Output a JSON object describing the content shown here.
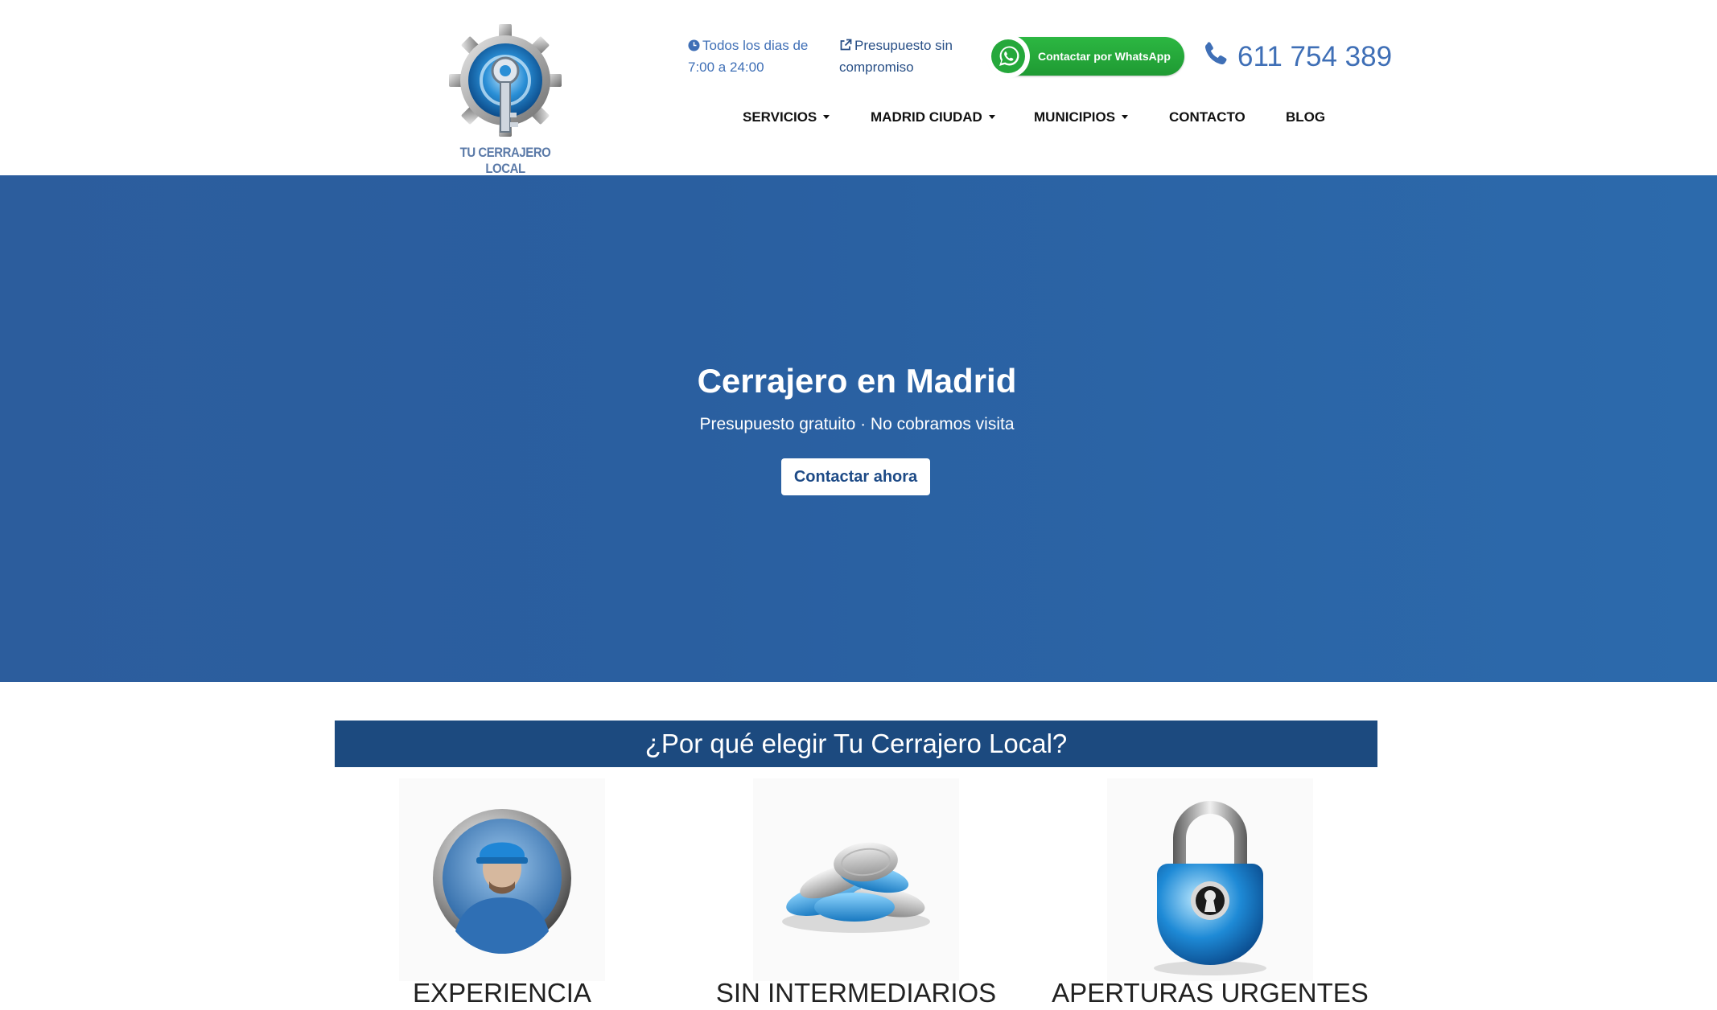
{
  "header": {
    "logo_text": "TU CERRAJERO LOCAL",
    "hours_text": "Todos los dias de 7:00 a 24:00",
    "quote_text": "Presupuesto sin compromiso",
    "whatsapp_label": "Contactar por WhatsApp",
    "phone": "611 754 389"
  },
  "nav": {
    "items": [
      {
        "label": "SERVICIOS",
        "dropdown": true
      },
      {
        "label": "MADRID CIUDAD",
        "dropdown": true
      },
      {
        "label": "MUNICIPIOS",
        "dropdown": true
      },
      {
        "label": "CONTACTO",
        "dropdown": false
      },
      {
        "label": "BLOG",
        "dropdown": false
      }
    ]
  },
  "hero": {
    "title": "Cerrajero en Madrid",
    "subtitle": "Presupuesto gratuito · No cobramos visita",
    "cta_label": "Contactar ahora"
  },
  "why": {
    "heading": "¿Por qué elegir Tu Cerrajero Local?",
    "features": [
      {
        "label": "EXPERIENCIA",
        "icon": "locksmith-worker-icon"
      },
      {
        "label": "SIN INTERMEDIARIOS",
        "icon": "coins-icon"
      },
      {
        "label": "APERTURAS URGENTES",
        "icon": "padlock-icon"
      }
    ]
  },
  "colors": {
    "brand_blue": "#3f6fb6",
    "hero_blue": "#2a5fa0",
    "heading_bar": "#1c4a7f",
    "whatsapp_green": "#25a83b"
  }
}
